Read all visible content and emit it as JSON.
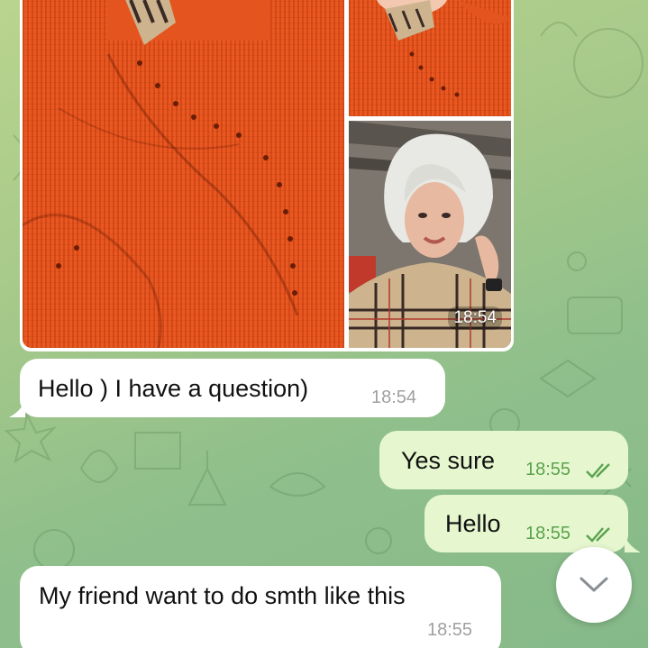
{
  "album": {
    "time": "18:54",
    "photos": [
      {
        "subject": "orange-knit-sweater"
      },
      {
        "subject": "orange-knit-sweater-top"
      },
      {
        "subject": "woman-portrait"
      }
    ]
  },
  "messages": [
    {
      "direction": "incoming",
      "text": "Hello ) I have a question)",
      "time": "18:54"
    },
    {
      "direction": "outgoing",
      "text": "Yes sure",
      "time": "18:55",
      "status": "read"
    },
    {
      "direction": "outgoing",
      "text": "Hello",
      "time": "18:55",
      "status": "read"
    },
    {
      "direction": "incoming",
      "text": "My friend want to do smth like this",
      "time": "18:55"
    }
  ],
  "colors": {
    "incoming_bubble": "#ffffff",
    "outgoing_bubble": "#e6f7cf",
    "outgoing_time": "#5aa24e",
    "incoming_time": "#a0a0a0",
    "wallpaper": "#a6c98a"
  },
  "icons": {
    "read_status": "double-check-icon",
    "scroll_down": "chevron-down-icon"
  }
}
